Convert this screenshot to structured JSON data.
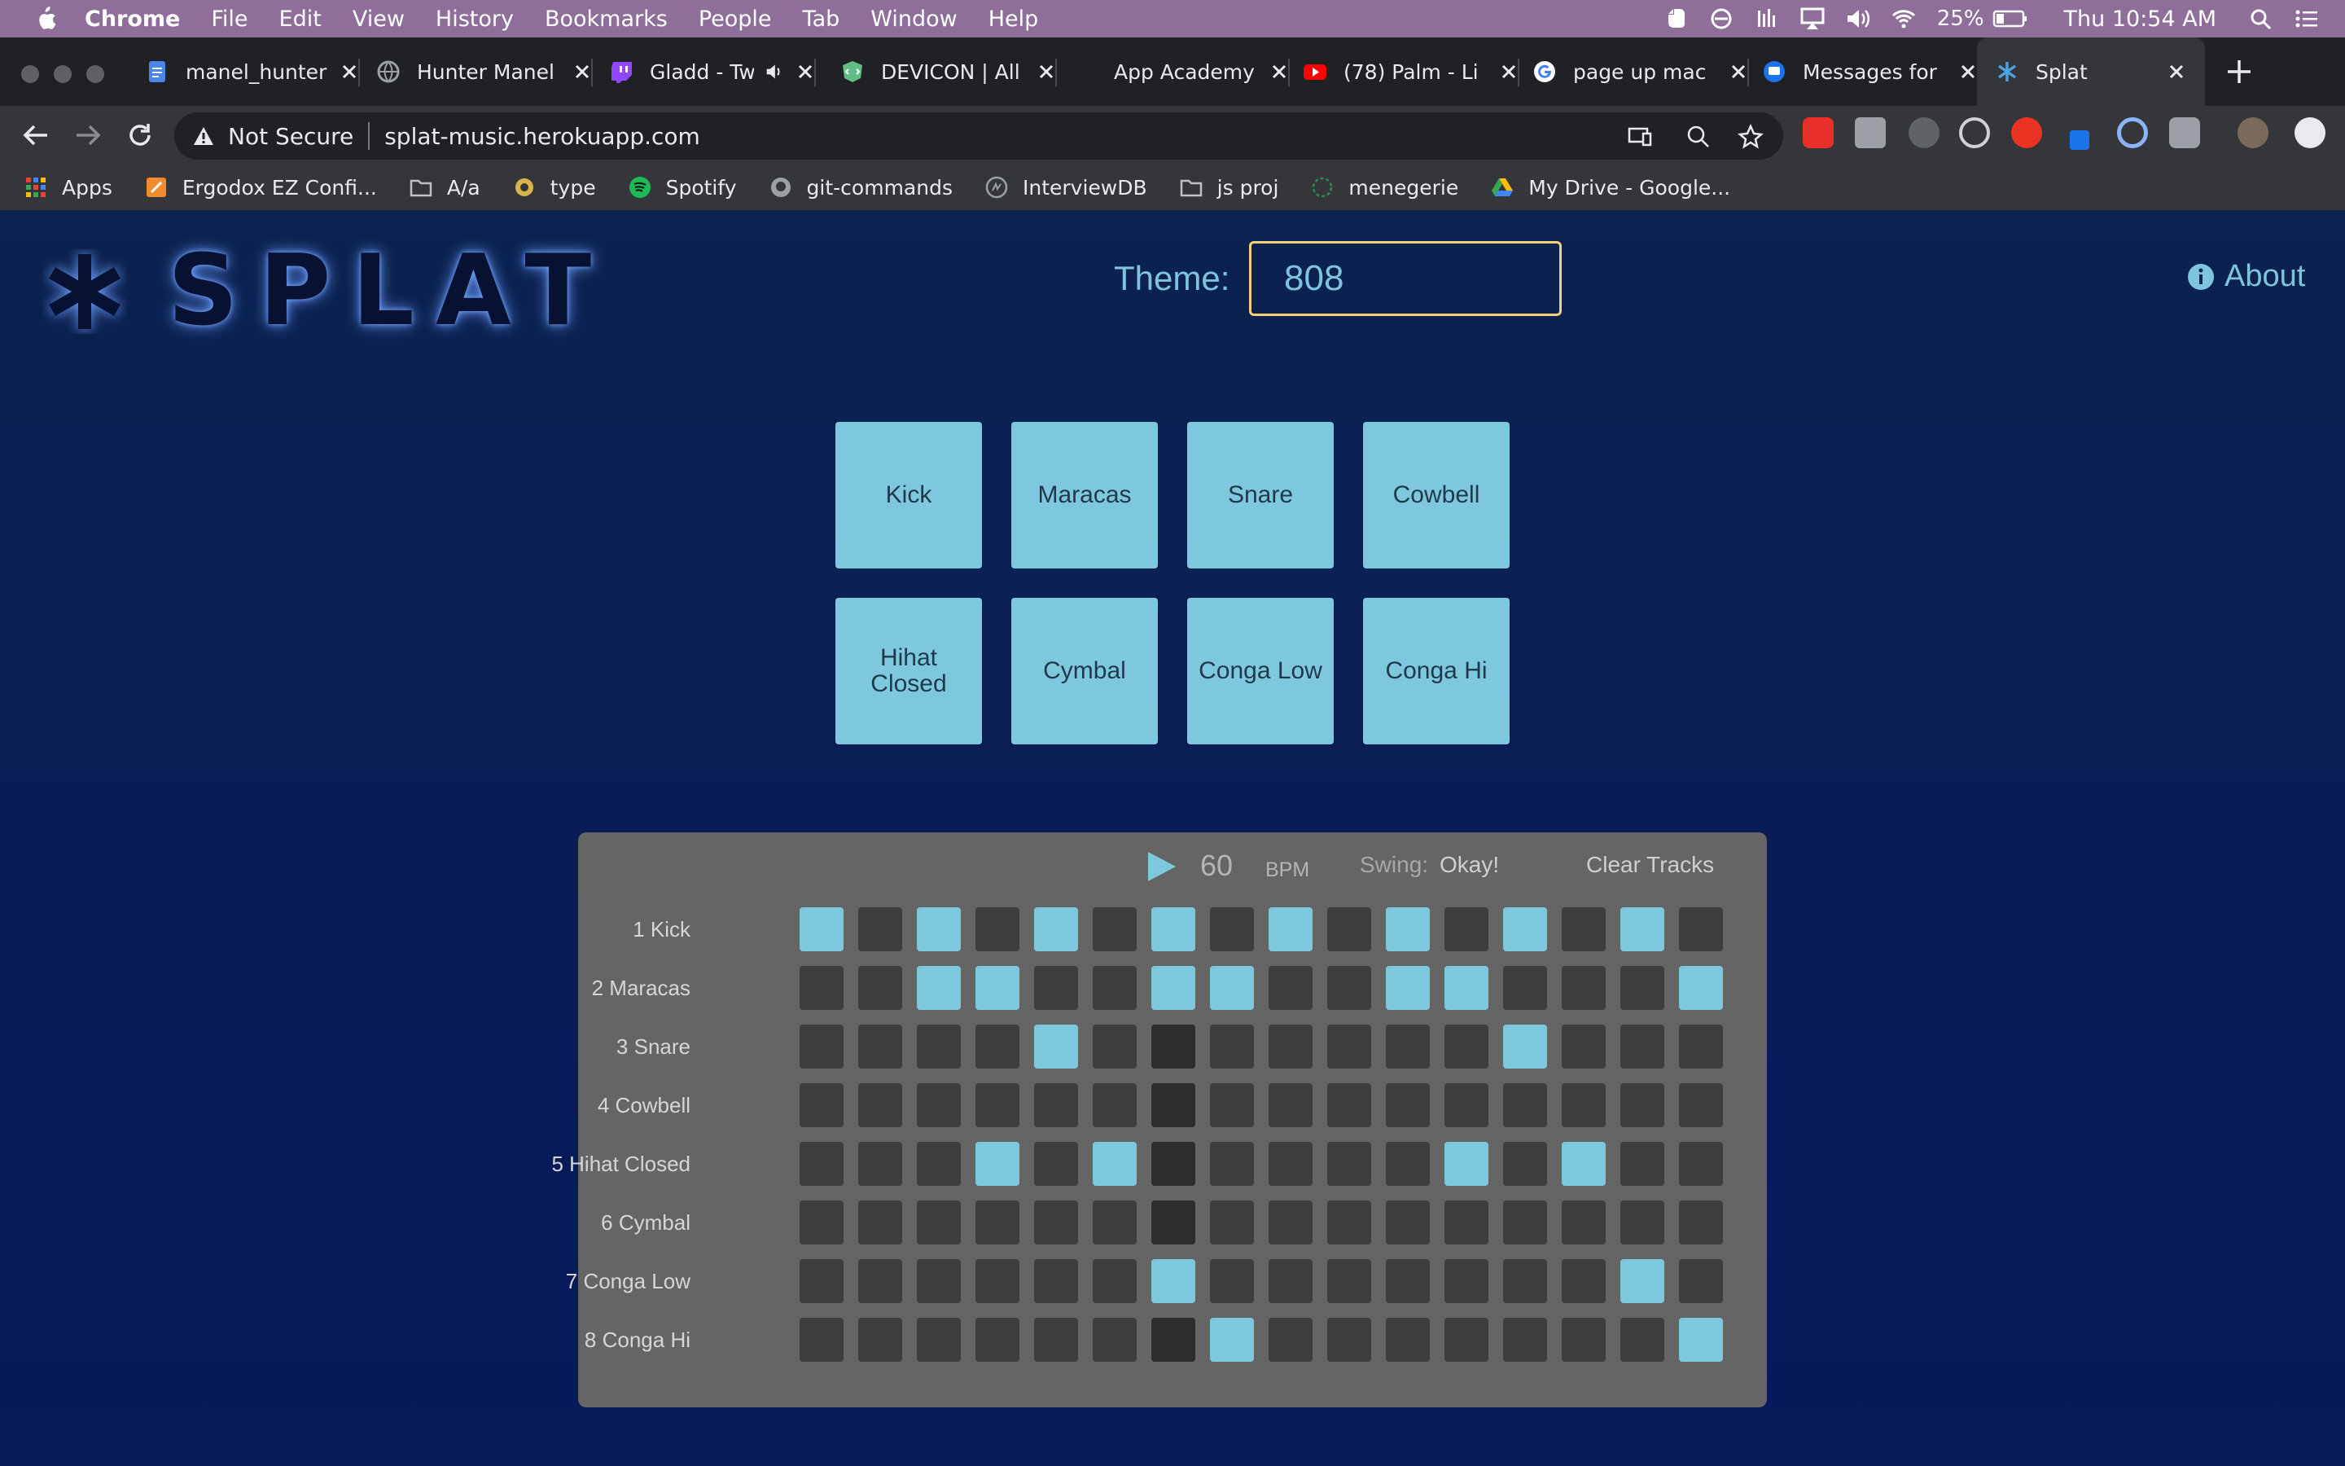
{
  "menubar": {
    "app": "Chrome",
    "items": [
      "File",
      "Edit",
      "View",
      "History",
      "Bookmarks",
      "People",
      "Tab",
      "Window",
      "Help"
    ],
    "battery": "25%",
    "clock": "Thu 10:54 AM"
  },
  "tabs": [
    {
      "title": "manel_hunter",
      "icon": "docs-icon",
      "color": "#4a86e8"
    },
    {
      "title": "Hunter Manel",
      "icon": "globe-icon",
      "color": "#9aa0a6"
    },
    {
      "title": "Gladd - Tw",
      "icon": "twitch-icon",
      "color": "#9146ff"
    },
    {
      "title": "DEVICON | All",
      "icon": "devicon-icon",
      "color": "#60be86"
    },
    {
      "title": "App Academy",
      "icon": "appacademy-icon",
      "color": "#202124"
    },
    {
      "title": "(78) Palm - Li",
      "icon": "youtube-icon",
      "color": "#ff0000"
    },
    {
      "title": "page up mac",
      "icon": "google-icon",
      "color": "#ffffff"
    },
    {
      "title": "Messages for",
      "icon": "messages-icon",
      "color": "#1a73e8"
    },
    {
      "title": "Splat",
      "icon": "splat-icon",
      "color": "#4aa3df"
    }
  ],
  "omnibox": {
    "security": "Not Secure",
    "url": "splat-music.herokuapp.com"
  },
  "bookmarks": [
    {
      "label": "Apps",
      "icon": "apps-grid-icon",
      "color": "#ea4335"
    },
    {
      "label": "Ergodox EZ Confi...",
      "icon": "ergodox-icon",
      "color": "#f28b30"
    },
    {
      "label": "A/a",
      "icon": "folder-icon",
      "color": "#c0c0c0"
    },
    {
      "label": "type",
      "icon": "type-icon",
      "color": "#d8b44a"
    },
    {
      "label": "Spotify",
      "icon": "spotify-icon",
      "color": "#1db954"
    },
    {
      "label": "git-commands",
      "icon": "github-icon",
      "color": "#9aa0a6"
    },
    {
      "label": "InterviewDB",
      "icon": "interviewdb-icon",
      "color": "#9aa0a6"
    },
    {
      "label": "js proj",
      "icon": "folder-icon",
      "color": "#c0c0c0"
    },
    {
      "label": "menegerie",
      "icon": "menegerie-icon",
      "color": "#2e8b57"
    },
    {
      "label": "My Drive - Google...",
      "icon": "drive-icon",
      "color": "#fbbc04"
    }
  ],
  "app": {
    "logo_text": "SPLAT",
    "theme_label": "Theme:",
    "theme_value": "808",
    "about_label": "About"
  },
  "pads": [
    "Kick",
    "Maracas",
    "Snare",
    "Cowbell",
    "Hihat Closed",
    "Cymbal",
    "Conga Low",
    "Conga Hi"
  ],
  "sequencer": {
    "bpm": "60",
    "bpm_label": "BPM",
    "swing_label": "Swing:",
    "swing_value": "Okay!",
    "clear_label": "Clear Tracks",
    "playhead_step": 7,
    "tracks": [
      {
        "label": "1 Kick",
        "steps": [
          1,
          0,
          1,
          0,
          1,
          0,
          1,
          0,
          1,
          0,
          1,
          0,
          1,
          0,
          1,
          0
        ]
      },
      {
        "label": "2 Maracas",
        "steps": [
          0,
          0,
          1,
          1,
          0,
          0,
          1,
          1,
          0,
          0,
          1,
          1,
          0,
          0,
          0,
          1
        ]
      },
      {
        "label": "3 Snare",
        "steps": [
          0,
          0,
          0,
          0,
          1,
          0,
          0,
          0,
          0,
          0,
          0,
          0,
          1,
          0,
          0,
          0
        ]
      },
      {
        "label": "4 Cowbell",
        "steps": [
          0,
          0,
          0,
          0,
          0,
          0,
          0,
          0,
          0,
          0,
          0,
          0,
          0,
          0,
          0,
          0
        ]
      },
      {
        "label": "5 Hihat Closed",
        "steps": [
          0,
          0,
          0,
          1,
          0,
          1,
          0,
          0,
          0,
          0,
          0,
          1,
          0,
          1,
          0,
          0
        ]
      },
      {
        "label": "6 Cymbal",
        "steps": [
          0,
          0,
          0,
          0,
          0,
          0,
          0,
          0,
          0,
          0,
          0,
          0,
          0,
          0,
          0,
          0
        ]
      },
      {
        "label": "7 Conga Low",
        "steps": [
          0,
          0,
          0,
          0,
          0,
          0,
          1,
          0,
          0,
          0,
          0,
          0,
          0,
          0,
          1,
          0
        ]
      },
      {
        "label": "8 Conga Hi",
        "steps": [
          0,
          0,
          0,
          0,
          0,
          0,
          0,
          1,
          0,
          0,
          0,
          0,
          0,
          0,
          0,
          1
        ]
      }
    ]
  },
  "colors": {
    "pad": "#7ec8de",
    "cell_on": "#7ec8de",
    "cell_off": "#3e3e3e",
    "playhead": "#2d2d2d",
    "accent": "#7fc4dd",
    "theme_border": "#f2d17a"
  }
}
